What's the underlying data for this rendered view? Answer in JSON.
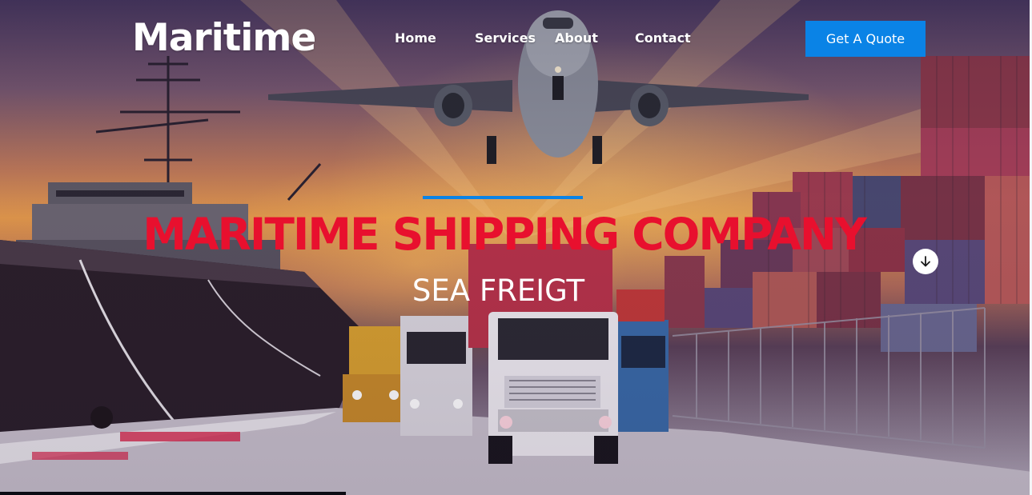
{
  "header": {
    "logo": "Maritime",
    "nav": {
      "home": "Home",
      "services": "Services",
      "about": "About",
      "contact": "Contact"
    },
    "cta_label": "Get A Quote"
  },
  "hero": {
    "title": "MARITIME SHIPPING COMPANY",
    "subtitle": "SEA FREIGT",
    "background_image": "airplane, cargo ship, trucks and shipping containers at port"
  },
  "icons": {
    "scroll_down": "arrow-down-icon"
  },
  "colors": {
    "accent_blue": "#0a83e6",
    "title_red": "#e8102e",
    "text_white": "#ffffff"
  }
}
